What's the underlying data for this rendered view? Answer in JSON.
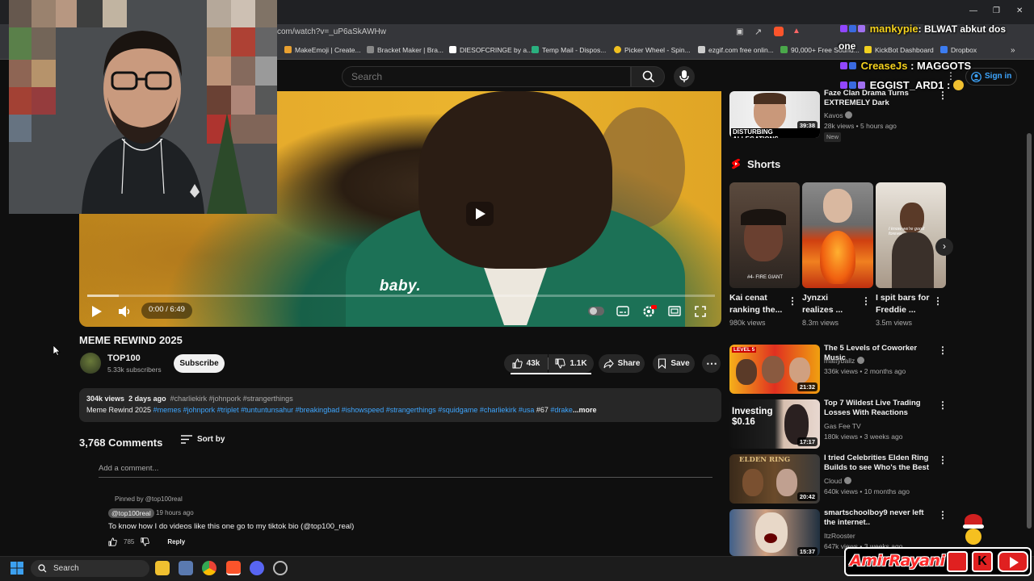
{
  "browser": {
    "url": "com/watch?v=_uP6aSkAWHw",
    "bookmarks": [
      {
        "label": "MakeEmoji | Create...",
        "color": "#e8a030"
      },
      {
        "label": "Bracket Maker | Bra...",
        "color": "#888888"
      },
      {
        "label": "DIESOFCRINGE by a...",
        "color": "#ffffff"
      },
      {
        "label": "Temp Mail - Dispos...",
        "color": "#2ab07f"
      },
      {
        "label": "Picker Wheel - Spin...",
        "color": "#f0c020"
      },
      {
        "label": "ezgif.com free onlin...",
        "color": "#cccccc"
      },
      {
        "label": "90,000+ Free Sound...",
        "color": "#4aa84a"
      },
      {
        "label": "KickBot Dashboard",
        "color": "#f0d020"
      },
      {
        "label": "Dropbox",
        "color": "#3c7cf0"
      }
    ]
  },
  "header": {
    "search_placeholder": "Search",
    "signin_label": "Sign in"
  },
  "player": {
    "subtitle": "baby.",
    "time": "0:00 / 6:49",
    "progress": 0.0,
    "buffered": 0.05
  },
  "video": {
    "title": "MEME REWIND 2025",
    "channel": "TOP100",
    "subscribers": "5.33k subscribers",
    "subscribe_label": "Subscribe",
    "likes": "43k",
    "dislikes": "1.1K",
    "share_label": "Share",
    "save_label": "Save"
  },
  "description": {
    "views": "304k views",
    "age": "2 days ago",
    "top_tags": "#charliekirk #johnpork #strangerthings",
    "title_text": "Meme Rewind 2025",
    "tags": "#memes #johnpork #triplet #tuntuntunsahur #breakingbad #ishowspeed #strangerthings #squidgame #charliekirk #usa",
    "num": "#67",
    "tail_tag": "#drake",
    "more": "...more"
  },
  "comments": {
    "count": "3,768 Comments",
    "sort_label": "Sort by",
    "add_placeholder": "Add a comment...",
    "pinned_label": "Pinned by @top100real",
    "author": "@top100real",
    "time": "19 hours ago",
    "text": "To know how I do videos like this one go to my tiktok bio (@top100_real)",
    "likes": "785",
    "reply_label": "Reply"
  },
  "sidebar": {
    "top_video": {
      "title": "Faze Clan Drama Turns EXTREMELY Dark",
      "channel": "Kavos",
      "meta": "28k views • 5 hours ago",
      "badge": "New",
      "duration": "39:38",
      "thumb_text": "DISTURBING ALLEGATIONS"
    },
    "shorts_label": "Shorts",
    "shorts": [
      {
        "title": "Kai cenat ranking the...",
        "views": "980k views",
        "thumb_text": "#4- FIRE GIANT"
      },
      {
        "title": "Jynzxi realizes ...",
        "views": "8.3m views",
        "thumb_text": ""
      },
      {
        "title": "I spit bars for Freddie ...",
        "views": "3.5m views",
        "thumb_text": "I know we're good forever"
      }
    ],
    "videos": [
      {
        "title": "The 5 Levels of Coworker Music",
        "channel": "mattyballz",
        "meta": "336k views • 2 months ago",
        "duration": "21:32",
        "thumb_text": "LEVEL 5"
      },
      {
        "title": "Top 7 Wildest Live Trading Losses With Reactions",
        "channel": "Gas Fee TV",
        "meta": "180k views • 3 weeks ago",
        "duration": "17:17",
        "thumb_text": "Investing $0.16"
      },
      {
        "title": "I tried Celebrities Elden Ring Builds to see Who's the Best",
        "channel": "Cloud",
        "meta": "640k views • 10 months ago",
        "duration": "20:42",
        "thumb_text": "ELDEN RING"
      },
      {
        "title": "smartschoolboy9 never left the internet..",
        "channel": "ItzRooster",
        "meta": "647k views • 3 weeks ago",
        "duration": "15:37",
        "thumb_text": ""
      }
    ]
  },
  "chat": [
    {
      "user": "mankypie",
      "message": ": BLWAT abkut dos",
      "extra": "one"
    },
    {
      "user": "CreaseJs",
      "message": ": MAGGOTS"
    },
    {
      "user": "EGGIST_ARD1",
      "message": ":"
    }
  ],
  "taskbar": {
    "search_label": "Search"
  },
  "streamer": {
    "name": "AmirRayani"
  },
  "colors": {
    "background": "#0f0f0f",
    "accent_red": "#ff0000",
    "link_blue": "#3ea6ff",
    "chat_yellow": "#f5d21e"
  }
}
